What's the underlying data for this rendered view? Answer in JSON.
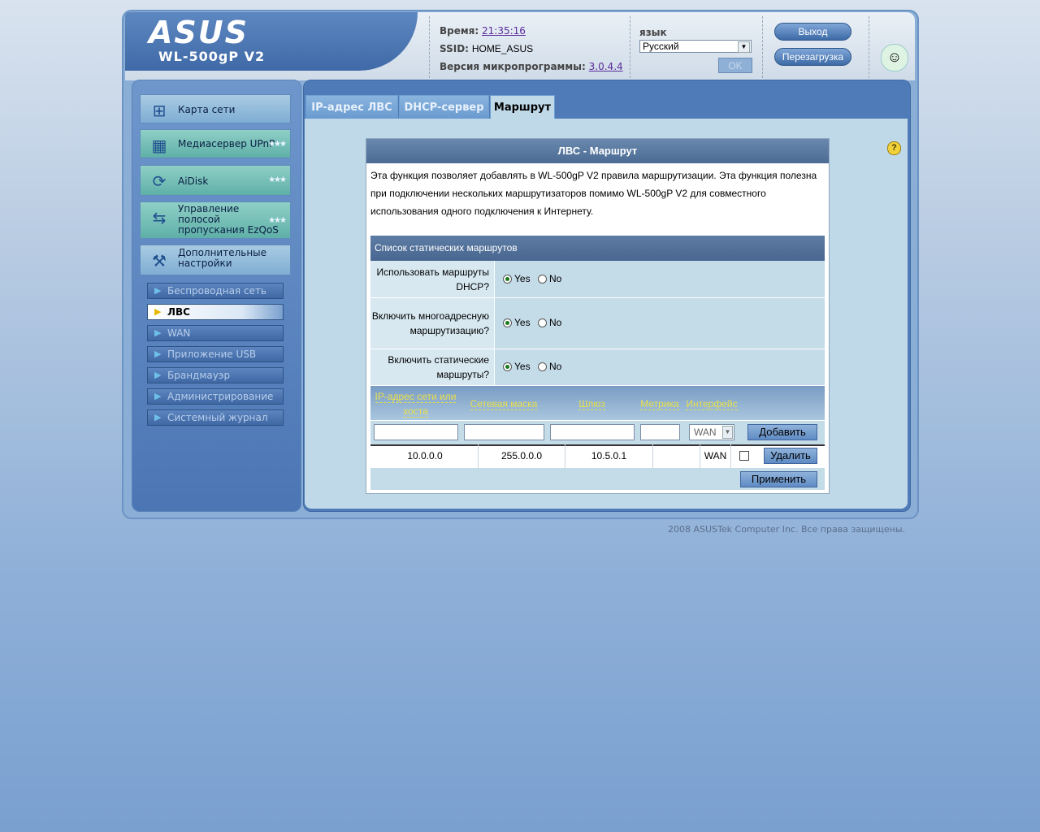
{
  "brand": {
    "logo_text": "ASUS",
    "model": "WL-500gP V2"
  },
  "info": {
    "time_label": "Время:",
    "time_value": "21:35:16",
    "ssid_label": "SSID:",
    "ssid_value": "HOME_ASUS",
    "fw_label": "Версия микропрограммы:",
    "fw_value": "3.0.4.4"
  },
  "language": {
    "label": "язык",
    "selected": "Русский",
    "ok_label": "OK"
  },
  "actions": {
    "logout": "Выход",
    "reboot": "Перезагрузка"
  },
  "sidebar": {
    "main_items": [
      {
        "label": "Карта сети",
        "icon": "network-map-icon"
      },
      {
        "label": "Медиасервер UPnP",
        "icon": "media-server-icon"
      },
      {
        "label": "AiDisk",
        "icon": "aidisk-icon"
      },
      {
        "label": "Управление полосой пропускания EzQoS",
        "icon": "qos-icon"
      },
      {
        "label": "Дополнительные настройки",
        "icon": "tools-icon"
      }
    ],
    "sub_items": [
      {
        "label": "Беспроводная сеть"
      },
      {
        "label": "ЛВС",
        "active": true
      },
      {
        "label": "WAN"
      },
      {
        "label": "Приложение USB"
      },
      {
        "label": "Брандмауэр"
      },
      {
        "label": "Администрирование"
      },
      {
        "label": "Системный журнал"
      }
    ]
  },
  "tabs": [
    {
      "label": "IP-адрес ЛВС"
    },
    {
      "label": "DHCP-сервер"
    },
    {
      "label": "Маршрут",
      "active": true
    }
  ],
  "panel": {
    "title": "ЛВС - Маршрут",
    "description": "Эта функция позволяет добавлять в WL-500gP V2 правила маршрутизации. Эта функция полезна при подключении нескольких маршрутизаторов помимо WL-500gP V2 для совместного использования одного подключения к Интернету.",
    "table_title": "Список статических маршрутов",
    "questions": [
      {
        "label": "Использовать маршруты DHCP?",
        "value": "Yes"
      },
      {
        "label": "Включить многоадресную маршрутизацию?",
        "value": "Yes"
      },
      {
        "label": "Включить статические маршруты?",
        "value": "Yes"
      }
    ],
    "yes_label": "Yes",
    "no_label": "No",
    "columns": [
      "IP-адрес сети или хоста",
      "Сетевая маска",
      "Шлюз",
      "Метрика",
      "Интерфейс"
    ],
    "interface_select": "WAN",
    "add_label": "Добавить",
    "routes": [
      {
        "ip": "10.0.0.0",
        "mask": "255.0.0.0",
        "gateway": "10.5.0.1",
        "metric": "",
        "interface": "WAN"
      }
    ],
    "delete_label": "Удалить",
    "apply_label": "Применить"
  },
  "footer": "2008 ASUSTek Computer Inc. Все права защищены."
}
